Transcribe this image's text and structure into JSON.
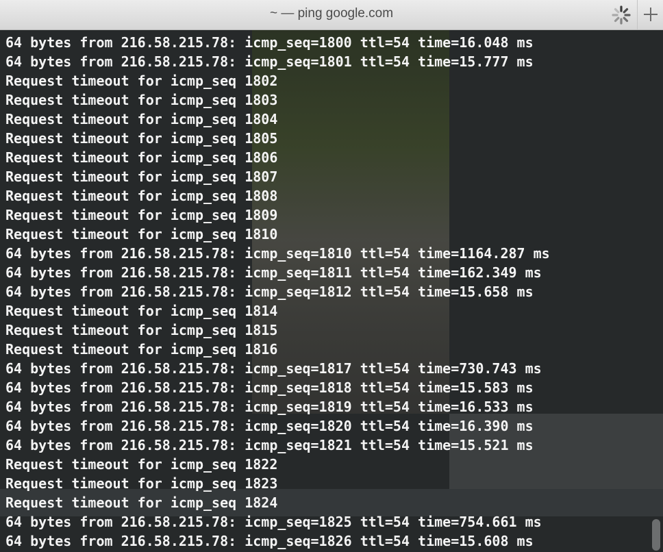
{
  "window": {
    "title": "~ — ping google.com"
  },
  "terminal": {
    "lines": [
      "64 bytes from 216.58.215.78: icmp_seq=1800 ttl=54 time=16.048 ms",
      "64 bytes from 216.58.215.78: icmp_seq=1801 ttl=54 time=15.777 ms",
      "Request timeout for icmp_seq 1802",
      "Request timeout for icmp_seq 1803",
      "Request timeout for icmp_seq 1804",
      "Request timeout for icmp_seq 1805",
      "Request timeout for icmp_seq 1806",
      "Request timeout for icmp_seq 1807",
      "Request timeout for icmp_seq 1808",
      "Request timeout for icmp_seq 1809",
      "Request timeout for icmp_seq 1810",
      "64 bytes from 216.58.215.78: icmp_seq=1810 ttl=54 time=1164.287 ms",
      "64 bytes from 216.58.215.78: icmp_seq=1811 ttl=54 time=162.349 ms",
      "64 bytes from 216.58.215.78: icmp_seq=1812 ttl=54 time=15.658 ms",
      "Request timeout for icmp_seq 1814",
      "Request timeout for icmp_seq 1815",
      "Request timeout for icmp_seq 1816",
      "64 bytes from 216.58.215.78: icmp_seq=1817 ttl=54 time=730.743 ms",
      "64 bytes from 216.58.215.78: icmp_seq=1818 ttl=54 time=15.583 ms",
      "64 bytes from 216.58.215.78: icmp_seq=1819 ttl=54 time=16.533 ms",
      "64 bytes from 216.58.215.78: icmp_seq=1820 ttl=54 time=16.390 ms",
      "64 bytes from 216.58.215.78: icmp_seq=1821 ttl=54 time=15.521 ms",
      "Request timeout for icmp_seq 1822",
      "Request timeout for icmp_seq 1823",
      "Request timeout for icmp_seq 1824",
      "64 bytes from 216.58.215.78: icmp_seq=1825 ttl=54 time=754.661 ms",
      "64 bytes from 216.58.215.78: icmp_seq=1826 ttl=54 time=15.608 ms"
    ]
  },
  "icons": {
    "spinner": "loading-spinner-icon",
    "new_tab": "plus-icon"
  },
  "colors": {
    "terminal_bg": "#26292a",
    "terminal_fg": "#f4f4f4",
    "titlebar_bg": "#e2e2e2",
    "title_fg": "#4b4b4b"
  }
}
